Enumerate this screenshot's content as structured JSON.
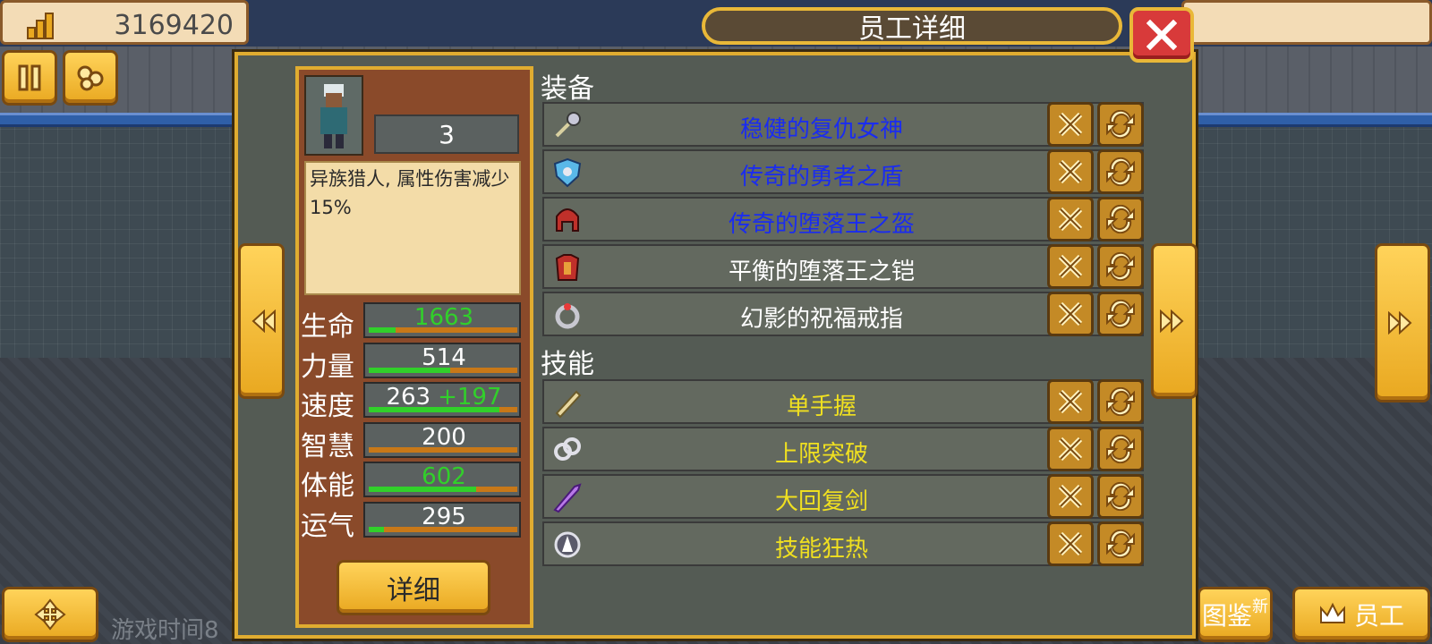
{
  "hud": {
    "money": "3169420",
    "game_time": "游戏时间8"
  },
  "panel": {
    "title": "员工详细"
  },
  "employee": {
    "level": "3",
    "description": "异族猎人, 属性伤害减少15%",
    "detail_label": "详细"
  },
  "stats": [
    {
      "label": "生命",
      "value": "1663",
      "bonus": "",
      "color": "#31d02a",
      "fill": 0.18
    },
    {
      "label": "力量",
      "value": "514",
      "bonus": "",
      "color": "#ffffff",
      "fill": 0.55
    },
    {
      "label": "速度",
      "value": "263",
      "bonus": "+197",
      "color": "#ffffff",
      "fill": 0.88
    },
    {
      "label": "智慧",
      "value": "200",
      "bonus": "",
      "color": "#ffffff",
      "fill": 0.0
    },
    {
      "label": "体能",
      "value": "602",
      "bonus": "",
      "color": "#31d02a",
      "fill": 0.72
    },
    {
      "label": "运气",
      "value": "295",
      "bonus": "",
      "color": "#ffffff",
      "fill": 0.1
    }
  ],
  "equipment": {
    "title": "装备",
    "items": [
      {
        "name": "稳健的复仇女神",
        "color": "#1a2cf0",
        "icon": "mace-icon"
      },
      {
        "name": "传奇的勇者之盾",
        "color": "#1a2cf0",
        "icon": "shield-icon"
      },
      {
        "name": "传奇的堕落王之盔",
        "color": "#1a2cf0",
        "icon": "helmet-icon"
      },
      {
        "name": "平衡的堕落王之铠",
        "color": "#ffffff",
        "icon": "armor-icon"
      },
      {
        "name": "幻影的祝福戒指",
        "color": "#ffffff",
        "icon": "ring-icon"
      }
    ]
  },
  "skills": {
    "title": "技能",
    "items": [
      {
        "name": "单手握",
        "color": "#f0e020",
        "icon": "hand-icon"
      },
      {
        "name": "上限突破",
        "color": "#f0e020",
        "icon": "chain-icon"
      },
      {
        "name": "大回复剑",
        "color": "#f0e020",
        "icon": "sword-icon"
      },
      {
        "name": "技能狂热",
        "color": "#f0e020",
        "icon": "orb-icon"
      }
    ]
  },
  "bottom_buttons": {
    "book_label": "图鉴",
    "book_badge": "新",
    "staff_label": "员工"
  }
}
